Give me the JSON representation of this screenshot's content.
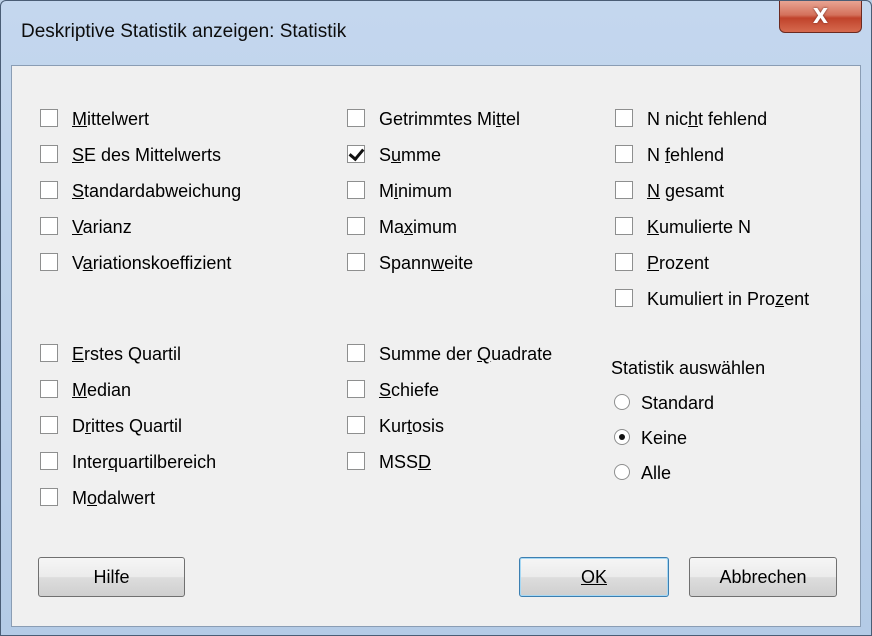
{
  "window": {
    "title": "Deskriptive Statistik anzeigen: Statistik",
    "close_glyph": "X"
  },
  "checkboxes": {
    "col1": [
      {
        "pre": "",
        "u": "M",
        "post": "ittelwert",
        "checked": false
      },
      {
        "pre": "",
        "u": "S",
        "post": "E des Mittelwerts",
        "checked": false
      },
      {
        "pre": "",
        "u": "S",
        "post": "tandardabweichung",
        "checked": false
      },
      {
        "pre": "",
        "u": "V",
        "post": "arianz",
        "checked": false
      },
      {
        "pre": "V",
        "u": "a",
        "post": "riationskoeffizient",
        "checked": false
      },
      {
        "pre": "",
        "u": "E",
        "post": "rstes Quartil",
        "checked": false
      },
      {
        "pre": "",
        "u": "M",
        "post": "edian",
        "checked": false
      },
      {
        "pre": "D",
        "u": "r",
        "post": "ittes Quartil",
        "checked": false
      },
      {
        "pre": "Inter",
        "u": "q",
        "post": "uartilbereich",
        "checked": false
      },
      {
        "pre": "M",
        "u": "o",
        "post": "dalwert",
        "checked": false
      }
    ],
    "col2": [
      {
        "pre": "Getrimmtes Mi",
        "u": "t",
        "post": "tel",
        "checked": false
      },
      {
        "pre": "S",
        "u": "u",
        "post": "mme",
        "checked": true
      },
      {
        "pre": "M",
        "u": "i",
        "post": "nimum",
        "checked": false
      },
      {
        "pre": "Ma",
        "u": "x",
        "post": "imum",
        "checked": false
      },
      {
        "pre": "Spann",
        "u": "w",
        "post": "eite",
        "checked": false
      },
      {
        "pre": "Summe der ",
        "u": "Q",
        "post": "uadrate",
        "checked": false
      },
      {
        "pre": "",
        "u": "S",
        "post": "chiefe",
        "checked": false
      },
      {
        "pre": "Kur",
        "u": "t",
        "post": "osis",
        "checked": false
      },
      {
        "pre": "MSS",
        "u": "D",
        "post": "",
        "checked": false
      }
    ],
    "col3": [
      {
        "pre": "N nic",
        "u": "h",
        "post": "t fehlend",
        "checked": false
      },
      {
        "pre": "N ",
        "u": "f",
        "post": "ehlend",
        "checked": false
      },
      {
        "pre": "",
        "u": "N",
        "post": " gesamt",
        "checked": false
      },
      {
        "pre": "",
        "u": "K",
        "post": "umulierte N",
        "checked": false
      },
      {
        "pre": "",
        "u": "P",
        "post": "rozent",
        "checked": false
      },
      {
        "pre": "Kumuliert in Pro",
        "u": "z",
        "post": "ent",
        "checked": false
      }
    ]
  },
  "statistik_auswaehlen": {
    "label": "Statistik auswählen",
    "options": [
      {
        "label": "Standard",
        "selected": false
      },
      {
        "label": "Keine",
        "selected": true
      },
      {
        "label": "Alle",
        "selected": false
      }
    ]
  },
  "buttons": {
    "help": "Hilfe",
    "ok": "OK",
    "cancel": "Abbrechen"
  }
}
